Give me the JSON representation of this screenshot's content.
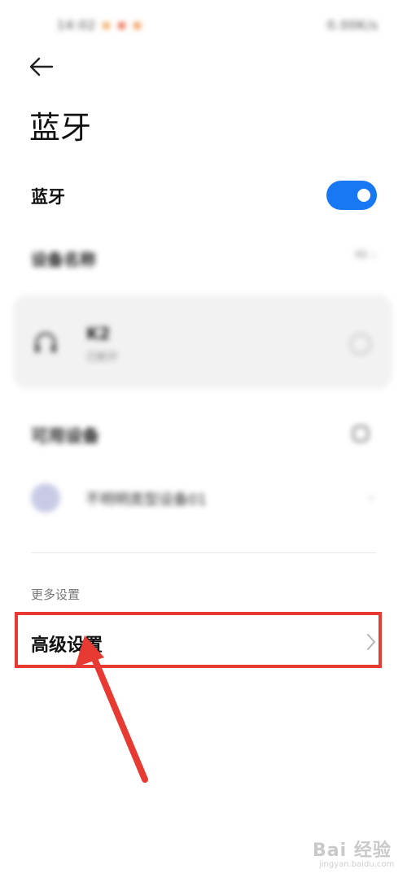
{
  "status_bar": {
    "left_text": "14:02",
    "right_text": "0.00K/s"
  },
  "header": {
    "title": "蓝牙"
  },
  "bluetooth": {
    "label": "蓝牙",
    "enabled": true
  },
  "device_name": {
    "label": "设备名称",
    "value": "Mi"
  },
  "paired_device": {
    "name": "K2",
    "status": "已断开"
  },
  "available": {
    "label": "可用设备",
    "items": [
      {
        "name": "不明明类型设备01"
      }
    ]
  },
  "more_settings": {
    "section_label": "更多设置",
    "advanced_label": "高级设置"
  },
  "watermark": {
    "brand": "Bai 经验",
    "url": "jingyan.baidu.com"
  },
  "colors": {
    "toggle_on": "#1878f3",
    "annotation": "#e73a32",
    "card_bg": "#f2f2f2"
  }
}
